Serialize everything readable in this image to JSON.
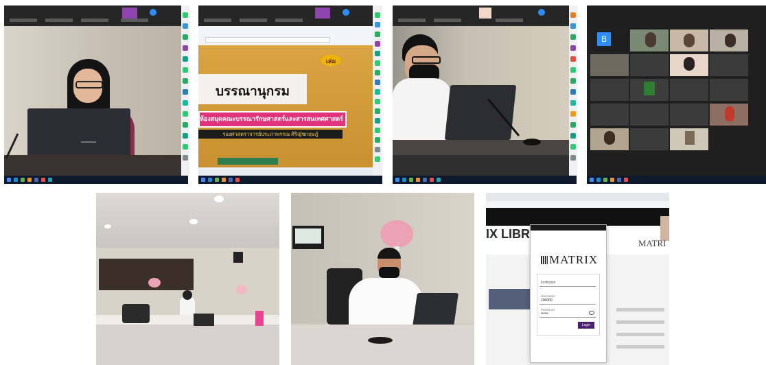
{
  "photo2": {
    "badge": "เล่ม",
    "slide_title": "บรรณานุกรม",
    "slide_banner": "ห้องสมุดคณะบรรณารักษศาสตร์และสารสนเทศศาสตร์",
    "slide_sub": "รองศาสตราจารย์ประภาพรรณ ศิริญัชกฤษฎ์"
  },
  "photo4": {
    "avatar_letter": "B"
  },
  "photo7": {
    "header_partial": "IX LIBRA",
    "app_logo": "MATRIX",
    "side_logo": "MATRI",
    "field_institution_label": "Institution",
    "field_username_label": "Username",
    "field_username_value": "100000",
    "field_password_label": "Password",
    "field_password_value": "••••••",
    "login_button": "Login"
  },
  "colors": {
    "zoom_bar": "#262626",
    "taskbar": "#0d1a2e",
    "slide_bg": "#c9912f",
    "banner": "#e0347a",
    "matrix_purple": "#4b1f6b"
  }
}
